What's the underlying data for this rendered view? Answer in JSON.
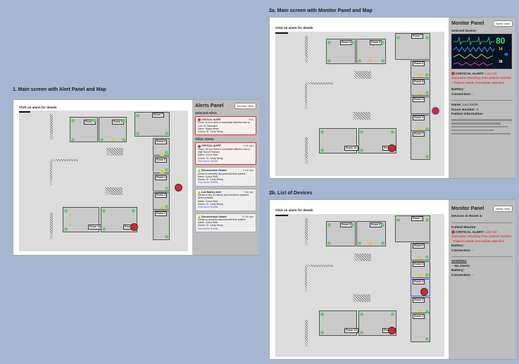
{
  "section1": {
    "title": "1. Main screen with Alert Panel and Map"
  },
  "section2a": {
    "title": "2a. Main screen with Monitor Panel and Map"
  },
  "section2b": {
    "title": "2b. List of Devices"
  },
  "map": {
    "hint": "Click on alarm for details",
    "rooms": {
      "r9": "Room 9",
      "r8": "Room 8",
      "r7": "Room 7",
      "r6": "Room 6",
      "r5": "Room 5",
      "r4": "Room 4",
      "r3": "Room 3",
      "r2": "Room 2",
      "r1a": "Room 1A",
      "r1b": "Room 1B",
      "r10": "Room 10"
    }
  },
  "alerts": {
    "title": "Alerts Panel",
    "monitor_view": "Monitor View",
    "selected_label": "Selected Alert:",
    "other_label": "Other Alerts:",
    "selected": {
      "type": "CRITICAL ALERT",
      "time": "Now",
      "text": "Room 1b is in need of immediate attention due to Low O2 Saturation",
      "name": "Name: Miyah Abadi",
      "doctor": "Doctor: Dr. Cindy Wong"
    },
    "items": [
      {
        "type": "CRITICAL ALERT",
        "time": "1 min ago",
        "text": "Room 1B is in need of immediate attention due to High Blood Pressure",
        "name": "Name: Conor Reid",
        "doctor": "Doctor: Dr. Cindy Wong",
        "link": "View Alarm Details"
      },
      {
        "type": "Disconnection Hazard",
        "time": "5 min ago",
        "text": "Device is currently disconnected from patient",
        "name": "Name: Conor Reid",
        "doctor": "Doctor: Dr. Cindy Wong",
        "link": "View Alarm Details"
      },
      {
        "type": "Low Battery Alert",
        "time": "7 min ago",
        "text": "Device is low on battery and should be replaced when possible",
        "name": "Name: Conor Reid",
        "doctor": "Doctor: Dr. Cindy Wong",
        "link": "View Alarm Details"
      },
      {
        "type": "Disconnection Hazard",
        "time": "10 min ago",
        "text": "Device is currently disconnected from patient",
        "name": "Name: Conor Reid",
        "doctor": "Doctor: Dr. Cindy Wong",
        "link": "View Alarm Details"
      }
    ]
  },
  "monitor": {
    "title": "Monitor Panel",
    "alerts_view": "Alerts View",
    "selected_device": "Selected Device:",
    "screen": {
      "v1": "80",
      "v2": "14",
      "v3": "46",
      "v4": "38"
    },
    "critical_label": "CRITICAL ALERT:",
    "critical_text": "Low O2 Saturation Reading from patient monitor - Patient needs immediate attention",
    "battery": "Battery:",
    "connection": "Connection:",
    "name_label": "Name:",
    "name": "Leo Smith",
    "room_label": "Room Number:",
    "room": "4",
    "patient_info": "Patient Information:"
  },
  "devices": {
    "title": "Monitor Panel",
    "alerts_view": "Alerts View",
    "devices_in": "Devices in Room 4:",
    "d1": {
      "name": "Patient Monitor",
      "critical_label": "CRITICAL ALERT:",
      "critical_text": "Low O2 Saturation Reading from patient monitor - Patient needs immediate attention",
      "battery": "Battery:",
      "connection": "Connection:"
    },
    "d2": {
      "name": "Ventilator",
      "no_alerts": "No Alerts:",
      "battery": "Battery:",
      "connection": "Connection:"
    }
  },
  "colors": {
    "background": "#a5b6d2",
    "critical": "#d8252d",
    "ok": "#5bd36b",
    "warning": "#e6c929",
    "link": "#3457c8"
  }
}
